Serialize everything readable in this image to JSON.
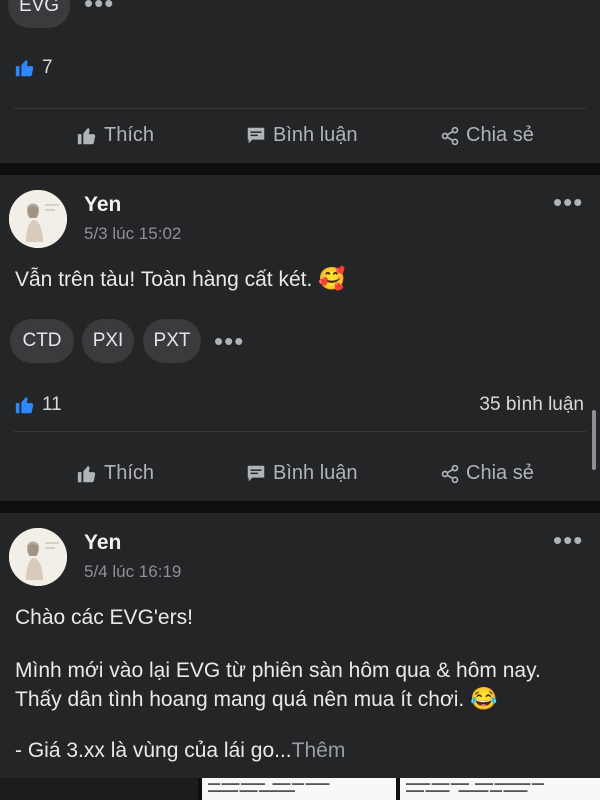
{
  "top_post": {
    "chips": [
      "EVG"
    ],
    "likes": "7"
  },
  "actions": {
    "like": "Thích",
    "comment": "Bình luận",
    "share": "Chia sẻ"
  },
  "post1": {
    "author": "Yen",
    "timestamp": "5/3 lúc 15:02",
    "text": "Vẫn trên tàu! Toàn hàng cất két.",
    "emoji": "🥰",
    "chips": [
      "CTD",
      "PXI",
      "PXT"
    ],
    "likes": "11",
    "comments": "35 bình luận"
  },
  "post2": {
    "author": "Yen",
    "timestamp": "5/4 lúc 16:19",
    "line1": "Chào các EVG'ers!",
    "line2": "Mình mới vào lại EVG từ phiên sàn hôm qua & hôm nay.",
    "line3": "Thấy dân tình hoang mang quá nên mua ít chơi.",
    "emoji": "😂",
    "line4": "- Giá 3.xx là vùng của lái go...",
    "more": "Thêm"
  },
  "colors": {
    "card": "#242526",
    "background": "#0f0f10",
    "like_blue": "#2d88ff",
    "muted": "#b0b3b8"
  }
}
